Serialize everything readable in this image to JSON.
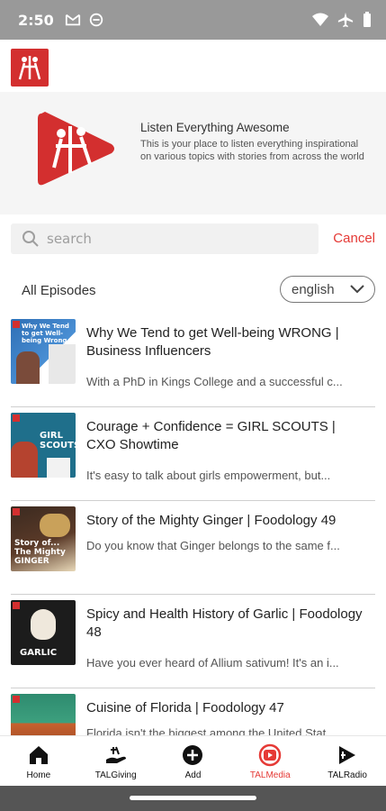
{
  "status": {
    "time": "2:50"
  },
  "hero": {
    "title": "Listen Everything Awesome",
    "description": "This is your place to listen everything inspirational on various topics with stories from across the world"
  },
  "search": {
    "placeholder": "search",
    "cancel_label": "Cancel"
  },
  "list": {
    "heading": "All Episodes",
    "language": "english",
    "items": [
      {
        "title": "Why We Tend to get Well-being WRONG | Business Influencers",
        "description": "With a PhD in Kings College and a successful c..."
      },
      {
        "title": "Courage + Confidence = GIRL SCOUTS | CXO Showtime",
        "description": "It's easy to talk about girls empowerment, but..."
      },
      {
        "title": "Story of the Mighty Ginger | Foodology 49",
        "description": "Do you know that Ginger belongs to the same f..."
      },
      {
        "title": "Spicy and Health History of Garlic | Foodology 48",
        "description": "Have you ever heard of Allium sativum! It's an i..."
      },
      {
        "title": "Cuisine of Florida | Foodology 47",
        "description": "Florida isn't the biggest among the United Stat..."
      }
    ],
    "thumb_texts": {
      "item1": "Why We Tend to get Well-being Wrong",
      "item2": "GIRL SCOUTS",
      "item3": "Story of... The Mighty GINGER",
      "item4": "GARLIC"
    }
  },
  "nav": {
    "items": [
      {
        "label": "Home",
        "icon": "home-icon"
      },
      {
        "label": "TALGiving",
        "icon": "giving-hand-icon"
      },
      {
        "label": "Add",
        "icon": "add-circle-icon"
      },
      {
        "label": "TALMedia",
        "icon": "play-circle-icon"
      },
      {
        "label": "TALRadio",
        "icon": "radio-play-icon"
      }
    ],
    "active": "TALMedia"
  },
  "colors": {
    "accent": "#e53935",
    "brand_red": "#d32f2f",
    "status_bar": "#999999"
  }
}
